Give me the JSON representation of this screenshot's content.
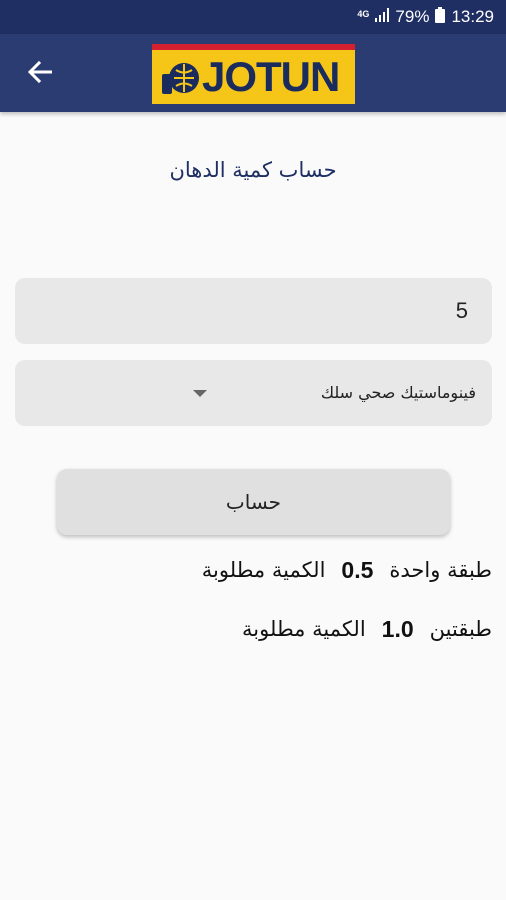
{
  "status_bar": {
    "network": "4G",
    "battery": "79%",
    "time": "13:29"
  },
  "app_bar": {
    "back_icon": "arrow-left-icon",
    "logo_text": "JOTUN"
  },
  "page": {
    "title": "حساب كمية الدهان"
  },
  "form": {
    "area_value": "5",
    "product_selected": "فينوماستيك صحي سلك",
    "calculate_label": "حساب"
  },
  "results": [
    {
      "label": "الكمية مطلوبة",
      "value": "0.5",
      "unit": "طبقة واحدة"
    },
    {
      "label": "الكمية مطلوبة",
      "value": "1.0",
      "unit": "طبقتين"
    }
  ],
  "colors": {
    "status_bar": "#1f2e63",
    "app_bar": "#2b3c72",
    "logo_yellow": "#f5c518",
    "logo_red": "#d62030",
    "title": "#1f2e63"
  }
}
